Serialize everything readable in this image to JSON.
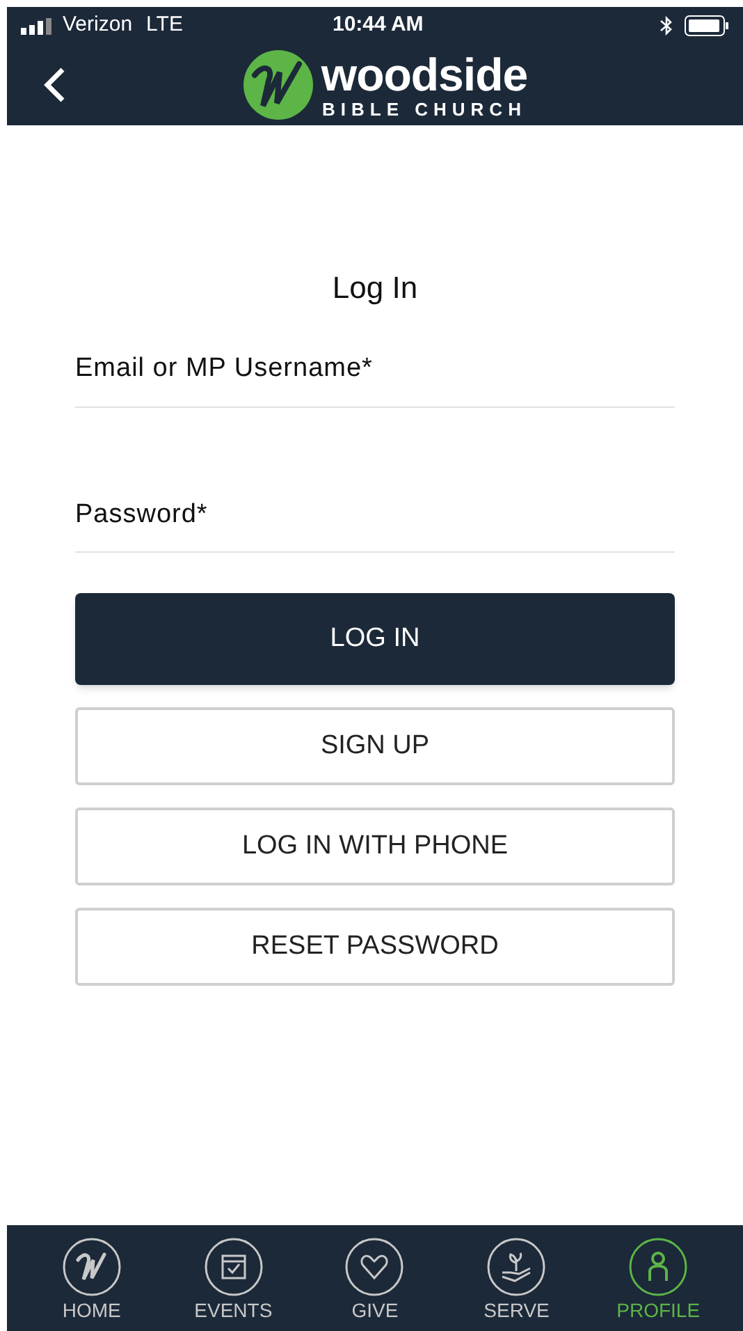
{
  "status_bar": {
    "carrier": "Verizon",
    "network": "LTE",
    "time": "10:44 AM"
  },
  "header": {
    "logo_name": "woodside",
    "logo_tagline": "BIBLE CHURCH"
  },
  "title": "Log In",
  "fields": [
    {
      "label": "Email or MP Username*"
    },
    {
      "label": "Password*"
    }
  ],
  "buttons": [
    {
      "label": "LOG IN",
      "kind": "primary"
    },
    {
      "label": "SIGN UP",
      "kind": "outline"
    },
    {
      "label": "LOG IN WITH PHONE",
      "kind": "outline"
    },
    {
      "label": "RESET PASSWORD",
      "kind": "outline"
    }
  ],
  "tab_bar": [
    {
      "label": "HOME",
      "kind": "home",
      "selected": false
    },
    {
      "label": "EVENTS",
      "kind": "events",
      "selected": false
    },
    {
      "label": "GIVE",
      "kind": "give",
      "selected": false
    },
    {
      "label": "SERVE",
      "kind": "serve",
      "selected": false
    },
    {
      "label": "PROFILE",
      "kind": "profile",
      "selected": true
    }
  ]
}
